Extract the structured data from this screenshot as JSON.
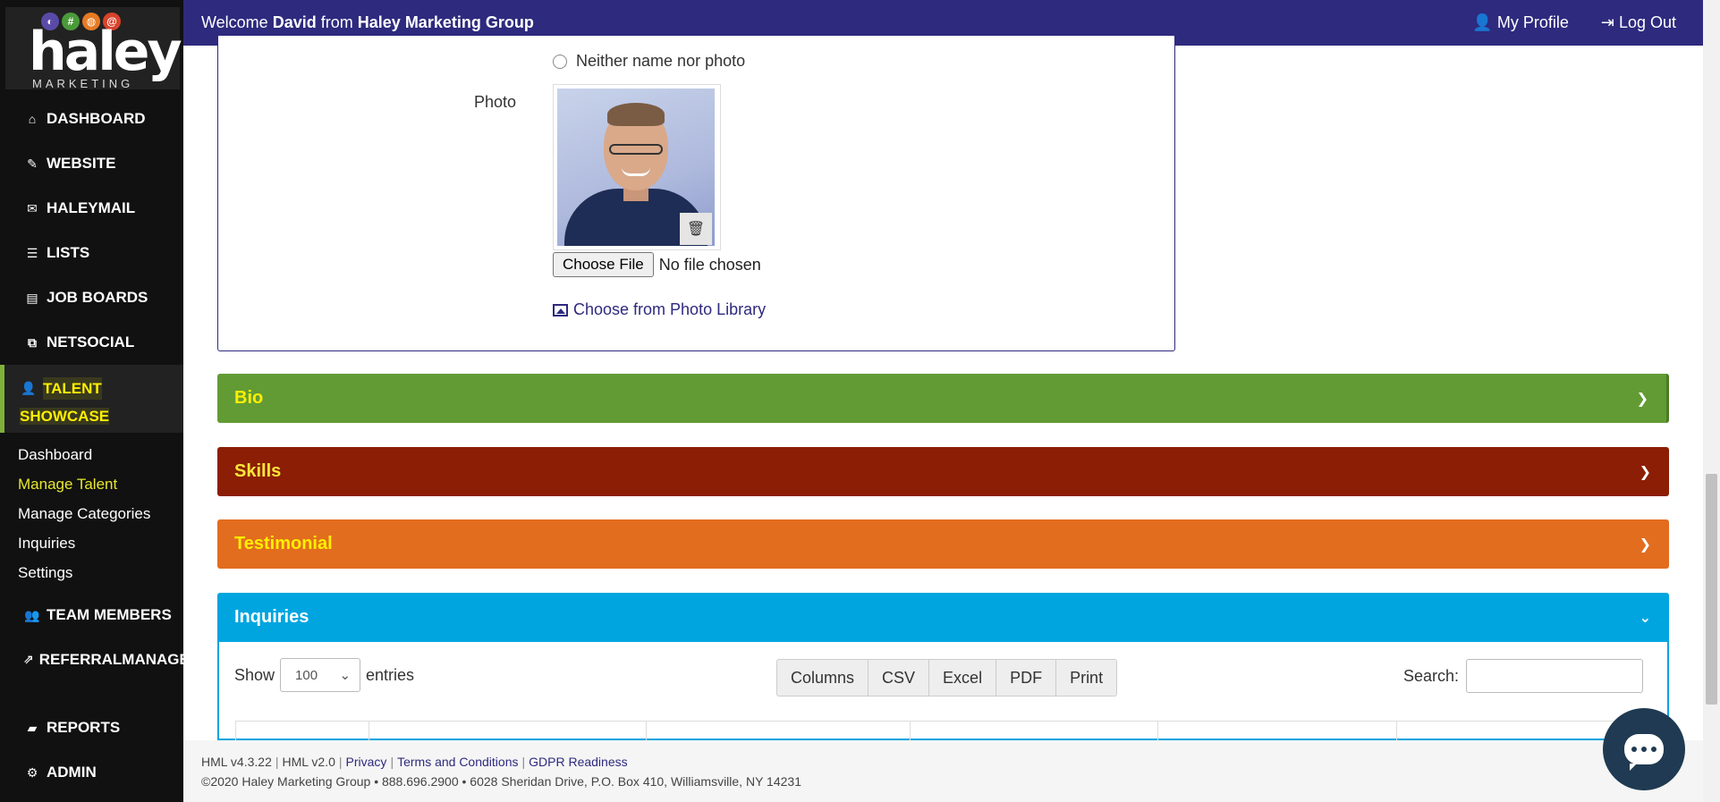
{
  "brand": {
    "name": "haley",
    "sub": "MARKETING",
    "dots": [
      "◐",
      "#",
      "◍",
      "@"
    ]
  },
  "topbar": {
    "welcome_prefix": "Welcome",
    "user": "David",
    "from": "from",
    "org": "Haley Marketing Group",
    "profile": "My Profile",
    "logout": "Log Out"
  },
  "nav": {
    "dashboard": "DASHBOARD",
    "website": "WEBSITE",
    "haleymail": "HALEYMAIL",
    "lists": "LISTS",
    "jobboards": "JOB BOARDS",
    "netsocial": "NETSOCIAL",
    "talent_1": "TALENT",
    "talent_2": "SHOWCASE",
    "sub": [
      "Dashboard",
      "Manage Talent",
      "Manage Categories",
      "Inquiries",
      "Settings"
    ],
    "team": "TEAM MEMBERS",
    "referral_1": "REFERRAL",
    "referral_2": "MANAGEMENT",
    "reports": "REPORTS",
    "admin": "ADMIN"
  },
  "photo_section": {
    "radio_label": "Neither name nor photo",
    "photo_label": "Photo",
    "choose_file": "Choose File",
    "no_file": "No file chosen",
    "library": "Choose from Photo Library"
  },
  "accordions": {
    "bio": "Bio",
    "skills": "Skills",
    "testimonial": "Testimonial",
    "inquiries": "Inquiries"
  },
  "table_controls": {
    "show": "Show",
    "entries_value": "100",
    "entries": "entries",
    "buttons": [
      "Columns",
      "CSV",
      "Excel",
      "PDF",
      "Print"
    ],
    "search": "Search:"
  },
  "footer": {
    "v1": "HML v4.3.22",
    "v2": "HML v2.0",
    "privacy": "Privacy",
    "terms": "Terms and Conditions",
    "gdpr": "GDPR Readiness",
    "address": "©2020 Haley Marketing Group • 888.696.2900 • 6028 Sheridan Drive, P.O. Box 410, Williamsville, NY 14231"
  },
  "colors": {
    "topbar": "#2e2a7e",
    "bio": "#629b34",
    "skills": "#8b1e04",
    "testimonial": "#e26d1f",
    "inquiries": "#00a5e0",
    "highlight": "#ffef00"
  }
}
